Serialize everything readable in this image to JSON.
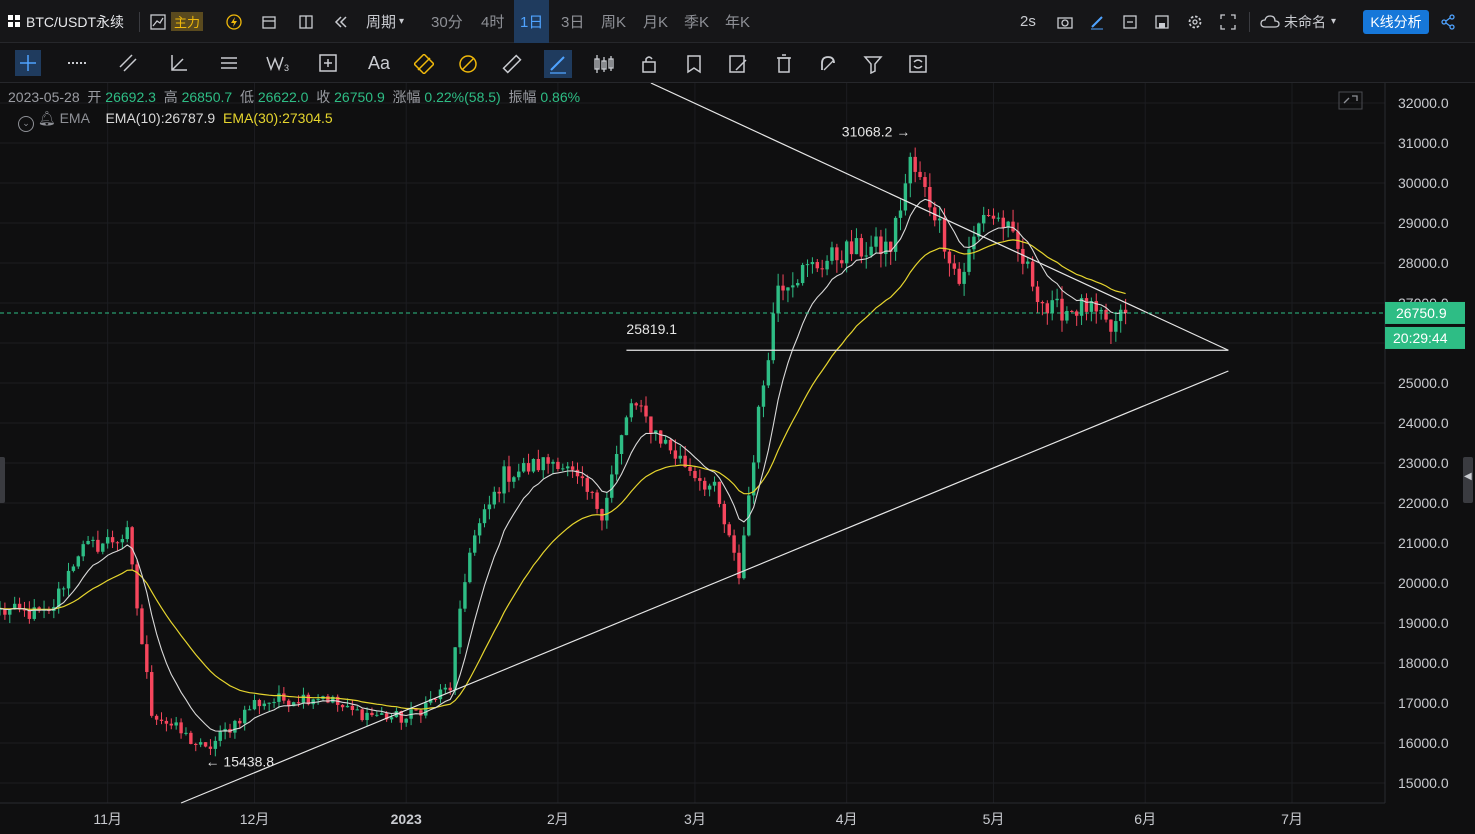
{
  "header": {
    "symbol": "BTC/USDT永续",
    "main_label": "主力",
    "period_label": "周期",
    "timeframes": [
      "30分",
      "4时",
      "1日",
      "3日",
      "周K",
      "月K",
      "季K",
      "年K"
    ],
    "active_timeframe": "1日",
    "refresh": "2s",
    "layout_name": "未命名",
    "kline_analysis": "K线分析"
  },
  "toolbar": {
    "font_tool": "Aa",
    "tools": [
      "crosshair-icon",
      "dotted-line-icon",
      "trend-lines-icon",
      "angle-icon",
      "parallel-lines-icon",
      "wave-icon",
      "add-box-icon",
      "text-icon",
      "gann-icon",
      "pattern-icon",
      "ruler-icon",
      "brush-icon",
      "candle-style-icon",
      "lock-icon",
      "note-icon",
      "edit-list-icon",
      "trash-icon",
      "magnet-icon",
      "filter-icon",
      "sync-icon"
    ]
  },
  "ohlc": {
    "date": "2023-05-28",
    "open_label": "开",
    "open": "26692.3",
    "high_label": "高",
    "high": "26850.7",
    "low_label": "低",
    "low": "26622.0",
    "close_label": "收",
    "close": "26750.9",
    "change_label": "涨幅",
    "change": "0.22%(58.5)",
    "amp_label": "振幅",
    "amp": "0.86%"
  },
  "indicator": {
    "name": "EMA",
    "ema10": "EMA(10):26787.9",
    "ema30": "EMA(30):27304.5"
  },
  "colors": {
    "up": "#2ebd85",
    "down": "#f6465d",
    "ema10": "#d9d9d9",
    "ema30": "#e6d52e",
    "accent": "#1677d9",
    "price_tag": "#2ebd85"
  },
  "chart_data": {
    "type": "candlestick",
    "y_axis_labels": [
      "32000.0",
      "31000.0",
      "30000.0",
      "29000.0",
      "28000.0",
      "27000.0",
      "26000.0",
      "25000.0",
      "24000.0",
      "23000.0",
      "22000.0",
      "21000.0",
      "20000.0",
      "19000.0",
      "18000.0",
      "17000.0",
      "16000.0",
      "15000.0"
    ],
    "ylim": [
      14500,
      32500
    ],
    "x_axis_labels": [
      "11月",
      "12月",
      "2023",
      "2月",
      "3月",
      "4月",
      "5月",
      "6月",
      "7月"
    ],
    "x_label_dates": [
      "2022-11-01",
      "2022-12-01",
      "2023-01-01",
      "2023-02-01",
      "2023-03-01",
      "2023-04-01",
      "2023-05-01",
      "2023-06-01",
      "2023-07-01"
    ],
    "date_range": [
      "2022-10-10",
      "2023-07-20"
    ],
    "current_price": "26750.9",
    "countdown": "20:29:44",
    "annotations": [
      {
        "text": "31068.2 →",
        "date": "2023-04-14",
        "price": 31068.2
      },
      {
        "text": "25819.1",
        "date": "2023-02-15",
        "price": 25819.1
      },
      {
        "text": "← 15438.8",
        "date": "2022-11-21",
        "price": 15438.8
      }
    ],
    "trendlines": [
      {
        "name": "upper-trendline",
        "from": [
          "2023-02-20",
          32500
        ],
        "to": [
          "2023-06-18",
          25819
        ]
      },
      {
        "name": "support-horizontal",
        "from": [
          "2023-02-15",
          25819.1
        ],
        "to": [
          "2023-06-18",
          25819.1
        ]
      },
      {
        "name": "lower-trendline",
        "from": [
          "2022-11-16",
          14500
        ],
        "to": [
          "2023-06-18",
          25300
        ]
      }
    ],
    "close_anchors": [
      [
        "2022-10-10",
        19300
      ],
      [
        "2022-10-20",
        19200
      ],
      [
        "2022-10-26",
        20800
      ],
      [
        "2022-11-05",
        21200
      ],
      [
        "2022-11-08",
        18500
      ],
      [
        "2022-11-10",
        16800
      ],
      [
        "2022-11-21",
        15800
      ],
      [
        "2022-12-01",
        17000
      ],
      [
        "2022-12-15",
        17200
      ],
      [
        "2022-12-20",
        16800
      ],
      [
        "2023-01-01",
        16600
      ],
      [
        "2023-01-10",
        17400
      ],
      [
        "2023-01-14",
        20900
      ],
      [
        "2023-01-21",
        22700
      ],
      [
        "2023-02-01",
        23100
      ],
      [
        "2023-02-10",
        21800
      ],
      [
        "2023-02-16",
        24500
      ],
      [
        "2023-02-25",
        23200
      ],
      [
        "2023-03-05",
        22300
      ],
      [
        "2023-03-10",
        20200
      ],
      [
        "2023-03-14",
        24200
      ],
      [
        "2023-03-18",
        27500
      ],
      [
        "2023-03-25",
        27900
      ],
      [
        "2023-04-01",
        28300
      ],
      [
        "2023-04-10",
        28400
      ],
      [
        "2023-04-14",
        30500
      ],
      [
        "2023-04-19",
        29300
      ],
      [
        "2023-04-24",
        27500
      ],
      [
        "2023-04-29",
        29300
      ],
      [
        "2023-05-03",
        29000
      ],
      [
        "2023-05-08",
        27800
      ],
      [
        "2023-05-12",
        26800
      ],
      [
        "2023-05-20",
        26900
      ],
      [
        "2023-05-25",
        26300
      ],
      [
        "2023-05-28",
        26750
      ]
    ]
  }
}
